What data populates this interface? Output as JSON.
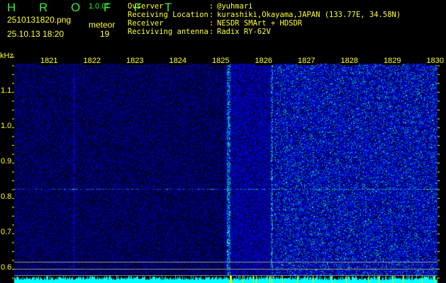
{
  "header": {
    "title": "H R O F F T",
    "version": "1.0.0f",
    "filename": "2510131820.png",
    "datetime": "25.10.13 18:20",
    "meteor_label": "meteor",
    "meteor_count": "19"
  },
  "info": [
    {
      "label": "Ovserver",
      "value": "@yuhmari"
    },
    {
      "label": "Receiving Location",
      "value": "kurashiki,Okayama,JAPAN (133.77E, 34.58N)"
    },
    {
      "label": "Receiver",
      "value": "NESDR SMArt + HDSDR"
    },
    {
      "label": "Reciviving antenna",
      "value": "Radix RY-62V"
    }
  ],
  "axis": {
    "unit": "kHz",
    "freq_labels": [
      "1821",
      "1822",
      "1823",
      "1824",
      "1825",
      "1826",
      "1827",
      "1828",
      "1829",
      "1830"
    ],
    "y_labels": [
      "1.1",
      "1.0",
      "0.9",
      "0.8",
      "0.7",
      "0.6"
    ]
  },
  "colors": {
    "text": "#ffff33",
    "title": "#33ee33",
    "spectrum": "#00ffff"
  }
}
